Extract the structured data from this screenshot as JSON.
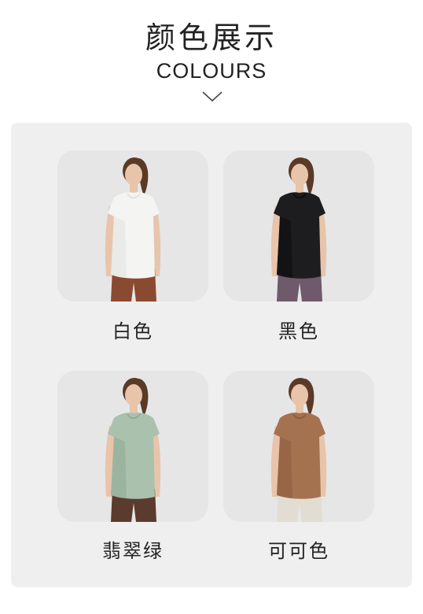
{
  "header": {
    "title_cn": "颜色展示",
    "title_en": "COLOURS",
    "chevron_icon": "chevron-down-icon"
  },
  "colors": [
    {
      "label": "白色",
      "shirt": "#f4f4f3",
      "shirt_shade": "#e2e2e0",
      "pants": "#8a4a31"
    },
    {
      "label": "黑色",
      "shirt": "#1d1d1f",
      "shirt_shade": "#0e0e10",
      "pants": "#6e5a6b"
    },
    {
      "label": "翡翠绿",
      "shirt": "#a9c1ad",
      "shirt_shade": "#93ab97",
      "pants": "#5a3b2e"
    },
    {
      "label": "可可色",
      "shirt": "#a57250",
      "shirt_shade": "#8e5f41",
      "pants": "#e2ddd2"
    }
  ],
  "theme": {
    "panel_bg": "#efefef",
    "card_bg": "#e6e6e7",
    "skin": "#e8c4aa",
    "hair": "#5a3a26"
  }
}
